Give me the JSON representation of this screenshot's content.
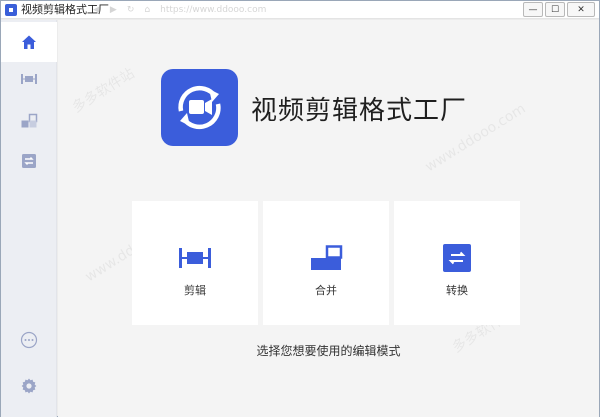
{
  "window": {
    "title": "视频剪辑格式工厂",
    "address_faint": "https://www.ddooo.com",
    "controls": {
      "minimize": "—",
      "maximize": "☐",
      "close": "✕"
    }
  },
  "sidebar": {
    "items": [
      {
        "name": "home",
        "icon": "home-icon",
        "active": true
      },
      {
        "name": "cut",
        "icon": "cut-icon",
        "active": false
      },
      {
        "name": "merge",
        "icon": "merge-icon",
        "active": false
      },
      {
        "name": "convert",
        "icon": "convert-icon",
        "active": false
      }
    ],
    "bottom": [
      {
        "name": "more",
        "icon": "more-icon"
      },
      {
        "name": "settings",
        "icon": "gear-icon"
      }
    ]
  },
  "main": {
    "app_name": "视频剪辑格式工厂",
    "cards": [
      {
        "label": "剪辑",
        "icon": "cut-icon"
      },
      {
        "label": "合并",
        "icon": "merge-icon"
      },
      {
        "label": "转换",
        "icon": "convert-icon"
      }
    ],
    "hint": "选择您想要使用的编辑模式"
  },
  "watermark": {
    "text_cn": "多多软件站",
    "text_en": "www.ddooo.com"
  },
  "colors": {
    "accent": "#3b5ddb",
    "sidebar_icon": "#9ba5c7",
    "background": "#f4f4f4"
  }
}
